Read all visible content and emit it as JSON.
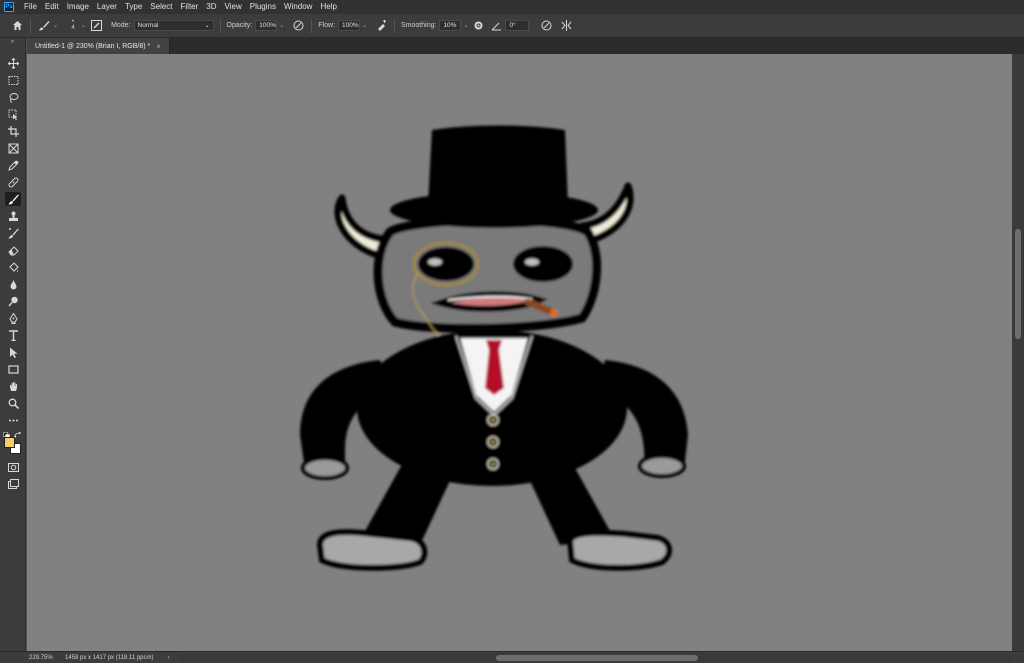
{
  "app": {
    "logo_text": "Ps",
    "menu": [
      "File",
      "Edit",
      "Image",
      "Layer",
      "Type",
      "Select",
      "Filter",
      "3D",
      "View",
      "Plugins",
      "Window",
      "Help"
    ]
  },
  "options": {
    "brush_size": "4",
    "mode_label": "Mode:",
    "mode_value": "Normal",
    "opacity_label": "Opacity:",
    "opacity_value": "100%",
    "flow_label": "Flow:",
    "flow_value": "100%",
    "smoothing_label": "Smoothing:",
    "smoothing_value": "10%",
    "angle_value": "0°"
  },
  "document": {
    "tab_title": "Untitled-1 @ 230% (Brian I, RGB/8) *",
    "tab_close": "×"
  },
  "status": {
    "zoom": "229.75%",
    "doc_info": "1458 px x 1417 px (118.11 ppcm)",
    "arrow": "›"
  },
  "colors": {
    "foreground": "#f5cd6b",
    "background": "#ffffff",
    "canvas": "#818181"
  },
  "tools": [
    "move-tool",
    "marquee-tool",
    "lasso-tool",
    "object-select-tool",
    "crop-tool",
    "frame-tool",
    "eyedropper-tool",
    "healing-brush-tool",
    "brush-tool",
    "clone-stamp-tool",
    "history-brush-tool",
    "eraser-tool",
    "paint-bucket-tool",
    "blur-tool",
    "dodge-tool",
    "pen-tool",
    "type-tool",
    "path-select-tool",
    "rectangle-tool",
    "hand-tool",
    "zoom-tool",
    "more-tools"
  ]
}
